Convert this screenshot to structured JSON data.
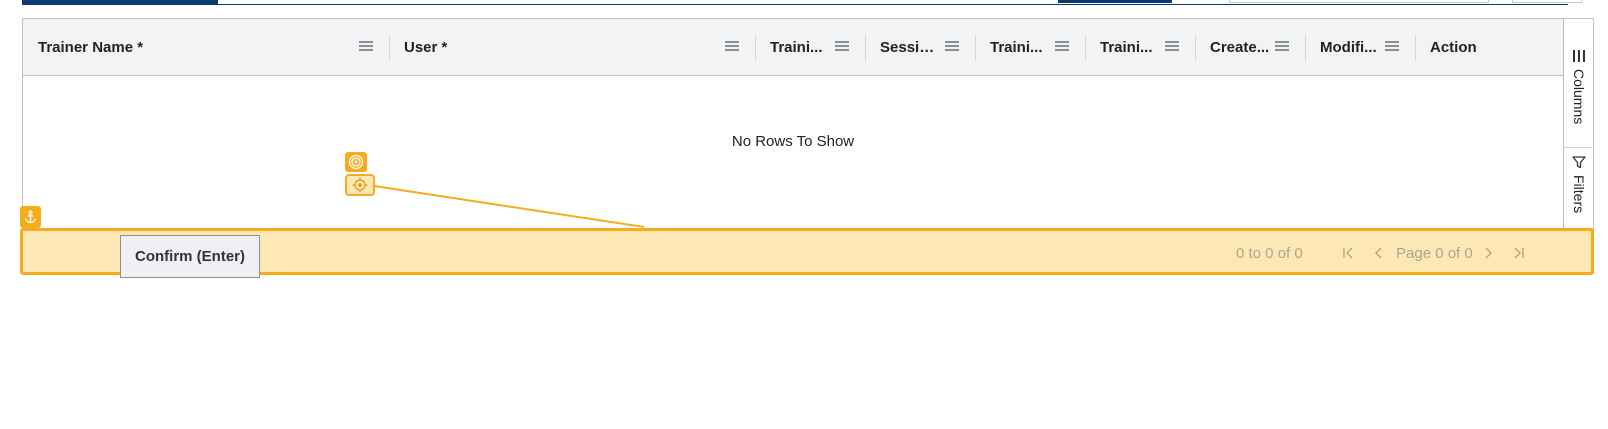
{
  "grid": {
    "columns": [
      {
        "label": "Trainer Name *"
      },
      {
        "label": "User *"
      },
      {
        "label": "Traini..."
      },
      {
        "label": "Sessio..."
      },
      {
        "label": "Traini..."
      },
      {
        "label": "Traini..."
      },
      {
        "label": "Create..."
      },
      {
        "label": "Modifi..."
      },
      {
        "label": "Action"
      }
    ],
    "empty_message": "No Rows To Show",
    "side_panel": {
      "columns_label": "Columns",
      "filters_label": "Filters"
    }
  },
  "pagination": {
    "summary": "0 to 0 of 0",
    "page_text": "Page 0 of 0"
  },
  "tooltip": {
    "text": "Confirm (Enter)"
  },
  "colors": {
    "highlight_border": "#f5ad1e",
    "highlight_fill": "#fde7b5",
    "header_bg": "#f1f3f5",
    "nav_blue": "#0b3a6e"
  }
}
